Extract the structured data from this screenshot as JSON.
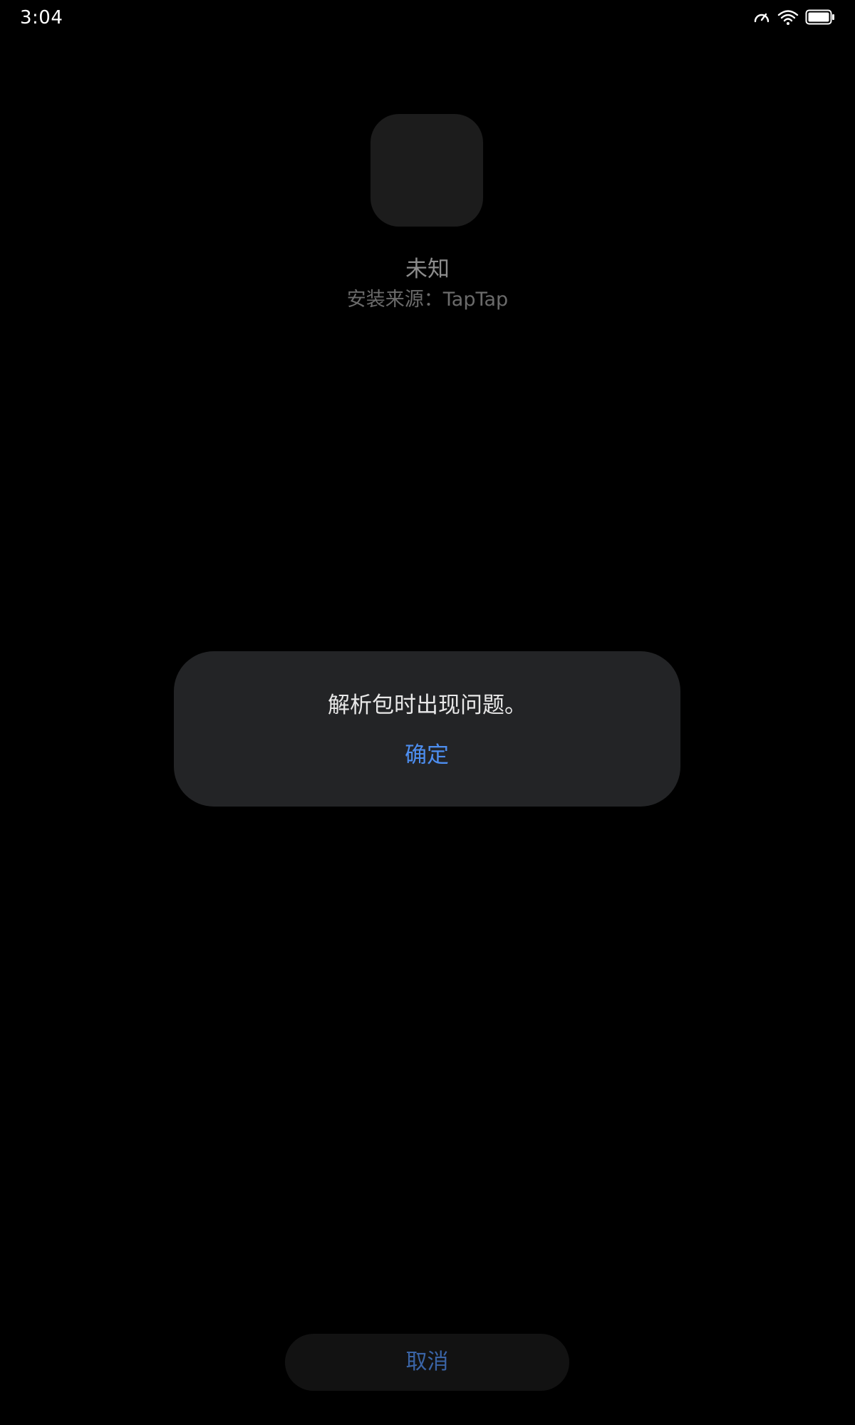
{
  "status_bar": {
    "time": "3:04",
    "icons": [
      "data-saver-icon",
      "wifi-icon",
      "battery-icon"
    ]
  },
  "app": {
    "name": "未知",
    "install_source": "安装来源：TapTap"
  },
  "dialog": {
    "message": "解析包时出现问题。",
    "confirm_label": "确定"
  },
  "footer": {
    "cancel_label": "取消"
  },
  "colors": {
    "background": "#000000",
    "dialog_background": "#232426",
    "accent": "#4d8ef0",
    "cancel_text": "#3a64a6"
  }
}
